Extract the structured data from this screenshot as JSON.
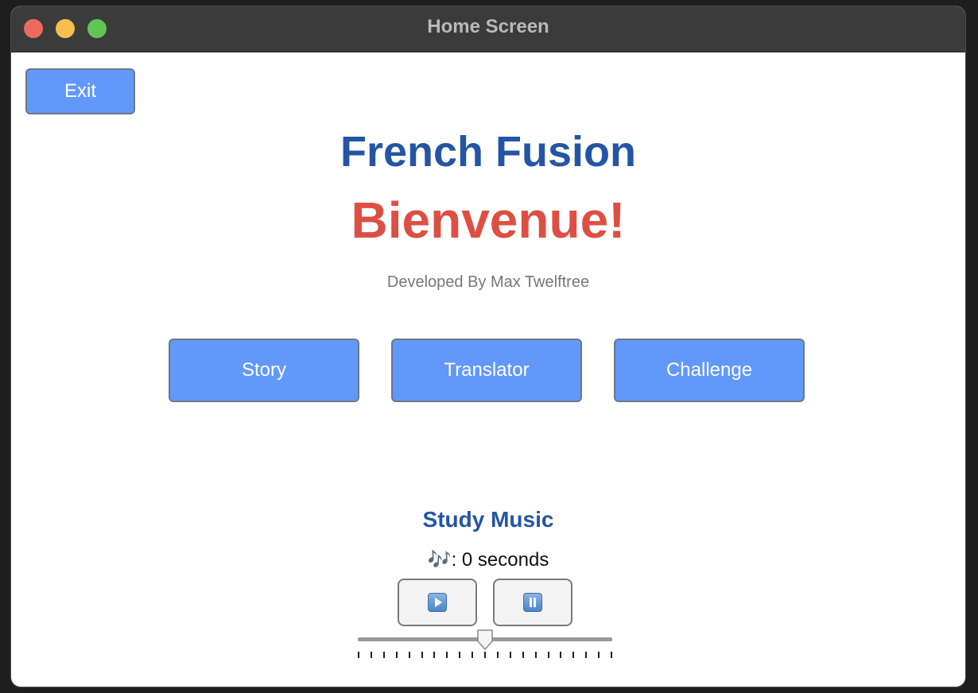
{
  "window": {
    "title": "Home Screen"
  },
  "toolbar": {
    "exit_label": "Exit"
  },
  "header": {
    "app_title": "French Fusion",
    "welcome": "Bienvenue!",
    "developer": "Developed By Max Twelftree"
  },
  "nav": {
    "story_label": "Story",
    "translator_label": "Translator",
    "challenge_label": "Challenge"
  },
  "music": {
    "title": "Study Music",
    "status": "🎶: 0 seconds",
    "play_icon": "play-icon",
    "pause_icon": "pause-icon",
    "volume_fraction": 0.5,
    "tick_count": 21
  },
  "colors": {
    "accent_button": "#6298f9",
    "title_blue": "#2455a5",
    "welcome_red": "#de4f43"
  }
}
